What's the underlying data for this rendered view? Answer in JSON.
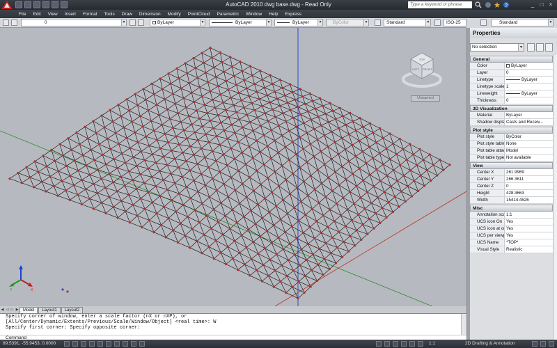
{
  "titlebar": {
    "title": "AutoCAD 2010    dwg base.dwg - Read Only",
    "search_placeholder": "Type a keyword or phrase"
  },
  "menu": [
    "File",
    "Edit",
    "View",
    "Insert",
    "Format",
    "Tools",
    "Draw",
    "Dimension",
    "Modify",
    "PointCloud",
    "Parametric",
    "Window",
    "Help",
    "Express"
  ],
  "toolbar": {
    "layer_value": "0",
    "color_value": "ByLayer",
    "linetype_value": "ByLayer",
    "lineweight_value": "ByLayer",
    "plotstyle_value": "ByColor",
    "textstyle_value": "Standard",
    "dimstyle_value": "ISO-25",
    "tablestyle_value": "Standard"
  },
  "viewport": {
    "viewcube_label": "Unnamed",
    "viewcube_faces": [
      "TOP",
      "LEFT",
      "FRONT"
    ],
    "ucs_axes": [
      "Y",
      "X"
    ]
  },
  "layout_tabs": [
    "Model",
    "Layout1",
    "Layout2"
  ],
  "command": {
    "history": [
      "Specify corner of window, enter a scale factor (nX or nXP), or",
      "[All/Center/Dynamic/Extents/Previous/Scale/Window/Object] <real time>: W",
      "Specify first corner: Specify opposite corner:"
    ],
    "prompt": "Command"
  },
  "statusbar": {
    "coords": "89.5391,  -55.9453, 0.0000",
    "annotation_scale": "1:1",
    "workspace": "2D Drafting & Annotation"
  },
  "properties": {
    "title": "Properties",
    "selection": "No selection",
    "sections": [
      {
        "name": "General",
        "rows": [
          {
            "key": "Color",
            "value": "ByLayer",
            "kind": "swatch"
          },
          {
            "key": "Layer",
            "value": "0"
          },
          {
            "key": "Linetype",
            "value": "ByLayer",
            "kind": "line"
          },
          {
            "key": "Linetype scale",
            "value": "1"
          },
          {
            "key": "Lineweight",
            "value": "ByLayer",
            "kind": "line"
          },
          {
            "key": "Thickness",
            "value": "0"
          }
        ]
      },
      {
        "name": "3D Visualization",
        "rows": [
          {
            "key": "Material",
            "value": "ByLayer"
          },
          {
            "key": "Shadow display",
            "value": "Casts and Receiv..."
          }
        ]
      },
      {
        "name": "Plot style",
        "rows": [
          {
            "key": "Plot style",
            "value": "ByColor"
          },
          {
            "key": "Plot style table",
            "value": "None"
          },
          {
            "key": "Plot table attac...",
            "value": "Model"
          },
          {
            "key": "Plot table type",
            "value": "Not available"
          }
        ]
      },
      {
        "name": "View",
        "rows": [
          {
            "key": "Center X",
            "value": "261.9969"
          },
          {
            "key": "Center Y",
            "value": "266.3611"
          },
          {
            "key": "Center Z",
            "value": "0"
          },
          {
            "key": "Height",
            "value": "428.3663"
          },
          {
            "key": "Width",
            "value": "15414.4526"
          }
        ]
      },
      {
        "name": "Misc",
        "rows": [
          {
            "key": "Annotation scale",
            "value": "1:1"
          },
          {
            "key": "UCS icon On",
            "value": "Yes"
          },
          {
            "key": "UCS icon at origin",
            "value": "Yes"
          },
          {
            "key": "UCS per viewport",
            "value": "Yes"
          },
          {
            "key": "UCS Name",
            "value": "*TOP*"
          },
          {
            "key": "Visual Style",
            "value": "Realistic"
          }
        ]
      }
    ]
  },
  "colors": {
    "mesh_line": "#1c1c1c",
    "mesh_node": "#b03030",
    "grid_green": "#2e8b2e",
    "grid_red": "#c03020",
    "grid_blue": "#2040d0",
    "viewport_bg": "#b6b9bf"
  }
}
